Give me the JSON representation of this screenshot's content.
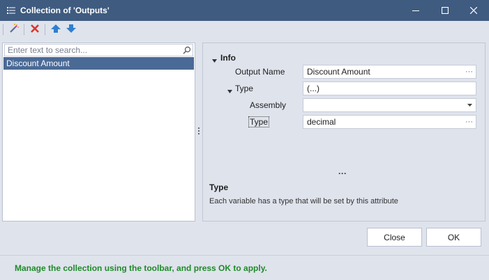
{
  "window": {
    "title": "Collection of 'Outputs'",
    "controls": [
      "minimize-icon",
      "maximize-icon",
      "close-icon"
    ],
    "titlebar_color": "#3f5b80"
  },
  "toolbar": {
    "items": [
      "add-icon",
      "delete-icon",
      "move-up-icon",
      "move-down-icon"
    ]
  },
  "list": {
    "search_placeholder": "Enter text to search...",
    "items": [
      "Discount Amount"
    ],
    "selected_index": 0,
    "selection_color": "#4a6a96"
  },
  "properties": {
    "category": "Info",
    "output_name": {
      "label": "Output Name",
      "value": "Discount Amount",
      "button": "···"
    },
    "type_group": {
      "label": "Type",
      "value": "(...)"
    },
    "assembly": {
      "label": "Assembly",
      "value": ""
    },
    "type": {
      "label": "Type",
      "value": "decimal",
      "button": "···"
    }
  },
  "more_indicator": "···",
  "description": {
    "title": "Type",
    "text": "Each variable has a type that will be set by this attribute"
  },
  "buttons": {
    "close": "Close",
    "ok": "OK"
  },
  "status": {
    "text": "Manage the collection using the toolbar, and press OK to apply.",
    "color": "#1f8a2a"
  }
}
